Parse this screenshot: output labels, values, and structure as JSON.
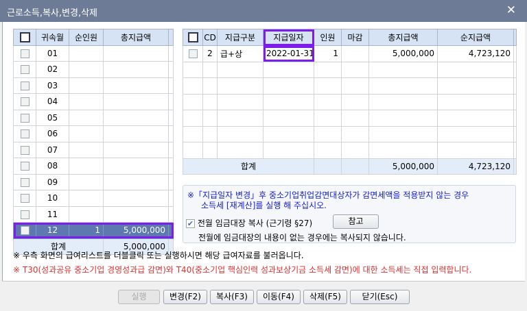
{
  "title": "근로소득,복사,변경,삭제",
  "left": {
    "headers": [
      "귀속월",
      "순인원",
      "총지급액"
    ],
    "rows": [
      {
        "m": "01",
        "p": "",
        "a": ""
      },
      {
        "m": "02",
        "p": "",
        "a": ""
      },
      {
        "m": "03",
        "p": "",
        "a": ""
      },
      {
        "m": "04",
        "p": "",
        "a": ""
      },
      {
        "m": "05",
        "p": "",
        "a": ""
      },
      {
        "m": "06",
        "p": "",
        "a": ""
      },
      {
        "m": "07",
        "p": "",
        "a": ""
      },
      {
        "m": "08",
        "p": "",
        "a": ""
      },
      {
        "m": "09",
        "p": "",
        "a": ""
      },
      {
        "m": "10",
        "p": "",
        "a": ""
      },
      {
        "m": "11",
        "p": "",
        "a": ""
      },
      {
        "m": "12",
        "p": "1",
        "a": "5,000,000"
      }
    ],
    "total_label": "합계",
    "total": "5,000,000"
  },
  "right": {
    "headers": [
      "CD",
      "지급구분",
      "지급일자",
      "인원",
      "마감",
      "총지급액",
      "순지급액"
    ],
    "rows": [
      {
        "cd": "2",
        "type": "급+상",
        "date": "2022-01-31",
        "n": "1",
        "close": "",
        "gross": "5,000,000",
        "net": "4,723,120"
      }
    ],
    "total_label": "합계",
    "total_gross": "5,000,000",
    "total_net": "4,723,120"
  },
  "info": {
    "notice1": "※「지급일자 변경」후 중소기업취업감면대상자가 감면세액을 적용받지 않는 경우",
    "notice2": "소득세 [재계산]를 실행 해 주십시오.",
    "copy_label": "전월 임금대장 복사 (근기령 §27)",
    "copy_checked": true,
    "ref_button": "참고",
    "copy_note": "전월에 임금대장의 내용이 없는 경우에는 복사되지 않습니다."
  },
  "note1": "※ 우측 화면의 급여리스트를 더블클릭 또는 실행하시면 해당 급여자료를 불러옵니다.",
  "note2": "※ T30(성과공유 중소기업 경영성과급 감면)와 T40(중소기업 핵심인력 성과보상기금 소득세 감면)에 대한 소득세는 직접 입력합니다.",
  "buttons": {
    "run": "실행",
    "change": "변경(F2)",
    "copy": "복사(F3)",
    "move": "이동(F4)",
    "delete": "삭제(F5)",
    "close": "닫기(Esc)"
  }
}
